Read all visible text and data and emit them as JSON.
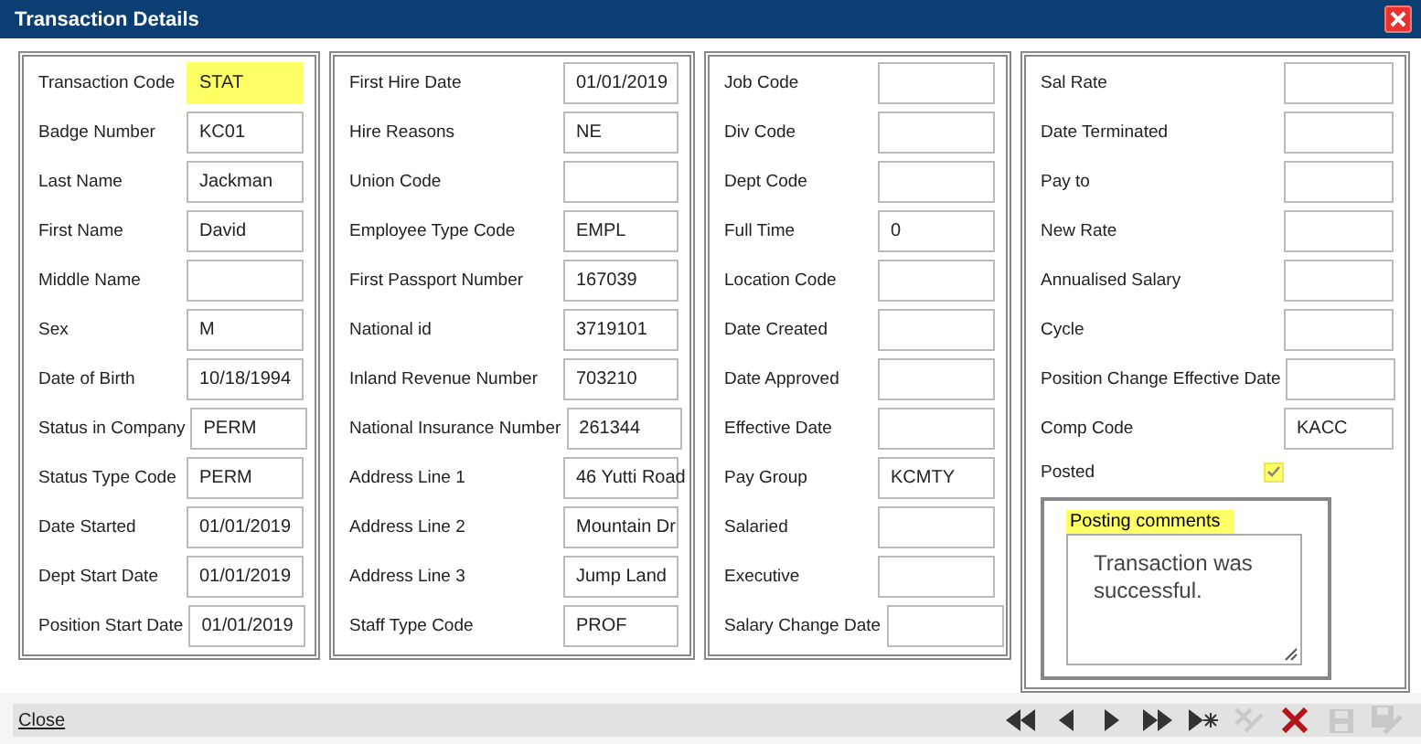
{
  "window": {
    "title": "Transaction Details"
  },
  "panels": [
    {
      "fields": [
        {
          "label": "Transaction Code",
          "value": "STAT",
          "highlighted": true
        },
        {
          "label": "Badge Number",
          "value": "KC01",
          "highlighted": false
        },
        {
          "label": "Last Name",
          "value": "Jackman",
          "highlighted": false
        },
        {
          "label": "First Name",
          "value": "David",
          "highlighted": false
        },
        {
          "label": "Middle Name",
          "highlighted": false
        },
        {
          "label": "Sex",
          "value": "M",
          "highlighted": false
        },
        {
          "label": "Date of Birth",
          "value": "10/18/1994",
          "highlighted": false
        },
        {
          "label": "Status in Company",
          "value": "PERM",
          "highlighted": false
        },
        {
          "label": "Status Type Code",
          "value": "PERM",
          "highlighted": false
        },
        {
          "label": "Date Started",
          "value": "01/01/2019",
          "highlighted": false
        },
        {
          "label": "Dept Start Date",
          "value": "01/01/2019",
          "highlighted": false
        },
        {
          "label": "Position Start Date",
          "value": "01/01/2019",
          "highlighted": false
        }
      ]
    },
    {
      "fields": [
        {
          "label": "First Hire Date",
          "value": "01/01/2019",
          "highlighted": false
        },
        {
          "label": "Hire Reasons",
          "value": "NE",
          "highlighted": false
        },
        {
          "label": "Union Code",
          "highlighted": false
        },
        {
          "label": "Employee Type Code",
          "value": "EMPL",
          "highlighted": false
        },
        {
          "label": "First Passport Number",
          "value": "167039",
          "highlighted": false
        },
        {
          "label": "National id",
          "value": "3719101",
          "highlighted": false
        },
        {
          "label": "Inland Revenue Number",
          "value": "703210",
          "highlighted": false
        },
        {
          "label": "National Insurance Number",
          "value": "261344",
          "highlighted": false
        },
        {
          "label": "Address Line 1",
          "value": "46 Yutti Road",
          "highlighted": false
        },
        {
          "label": "Address Line 2",
          "value": "Mountain Dr",
          "highlighted": false
        },
        {
          "label": "Address Line 3",
          "value": "Jump Land",
          "highlighted": false
        },
        {
          "label": "Staff Type Code",
          "value": "PROF",
          "highlighted": false
        }
      ]
    },
    {
      "fields": [
        {
          "label": "Job Code",
          "highlighted": false
        },
        {
          "label": "Div Code",
          "highlighted": false
        },
        {
          "label": "Dept Code",
          "highlighted": false
        },
        {
          "label": "Full Time",
          "value": "0",
          "highlighted": false
        },
        {
          "label": "Location Code",
          "highlighted": false
        },
        {
          "label": "Date Created",
          "highlighted": false
        },
        {
          "label": "Date Approved",
          "highlighted": false
        },
        {
          "label": "Effective Date",
          "highlighted": false
        },
        {
          "label": "Pay Group",
          "value": "KCMTY",
          "highlighted": false
        },
        {
          "label": "Salaried",
          "highlighted": false
        },
        {
          "label": "Executive",
          "highlighted": false
        },
        {
          "label": "Salary Change Date",
          "highlighted": false
        }
      ]
    },
    {
      "fields": [
        {
          "label": "Sal Rate",
          "highlighted": false
        },
        {
          "label": "Date Terminated",
          "highlighted": false
        },
        {
          "label": "Pay to",
          "highlighted": false
        },
        {
          "label": "New Rate",
          "highlighted": false
        },
        {
          "label": "Annualised Salary",
          "highlighted": false
        },
        {
          "label": "Cycle",
          "highlighted": false
        },
        {
          "label": "Position Change Effective Date",
          "highlighted": false
        },
        {
          "label": "Comp Code",
          "value": "KACC",
          "highlighted": false
        }
      ],
      "posted": {
        "label": "Posted",
        "checked": true,
        "highlighted": true
      },
      "comments": {
        "label": "Posting comments",
        "value": "Transaction was successful.",
        "highlighted": true
      }
    }
  ],
  "footer": {
    "link": "Close",
    "tools": [
      {
        "kind": "first",
        "disabled": false
      },
      {
        "kind": "prev",
        "disabled": false
      },
      {
        "kind": "next",
        "disabled": false
      },
      {
        "kind": "last",
        "disabled": false
      },
      {
        "kind": "new",
        "disabled": false
      },
      {
        "kind": "cancel",
        "disabled": true
      },
      {
        "kind": "delete",
        "disabled": false
      },
      {
        "kind": "save",
        "disabled": true
      },
      {
        "kind": "save-edit",
        "disabled": true
      }
    ]
  }
}
